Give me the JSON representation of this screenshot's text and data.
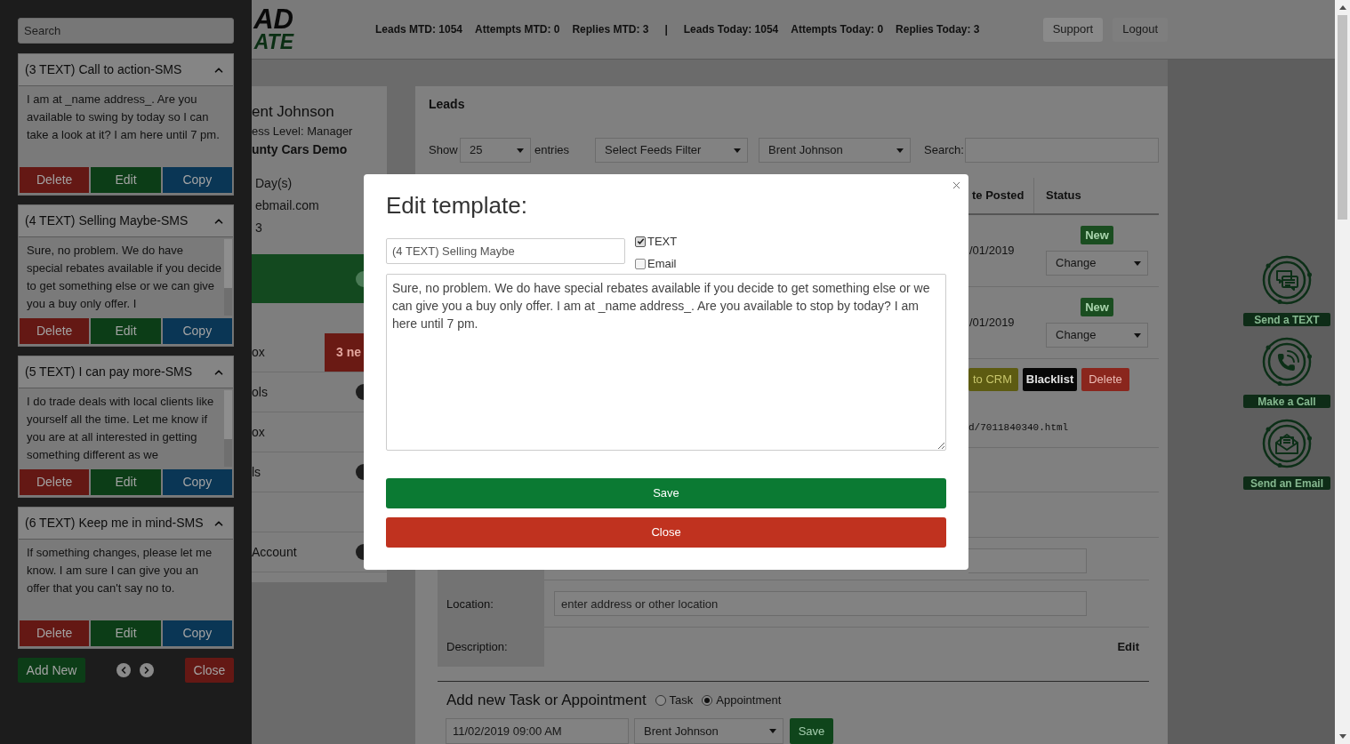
{
  "sidebar": {
    "search": {
      "placeholder": "Search"
    },
    "templates": [
      {
        "title": "(3 TEXT) Call to action-SMS",
        "expanded": true,
        "body": "I am at _name address_. Are you available to swing by today so I can take a look at it? I am here until 7 pm.",
        "scrollbar": false,
        "actions": [
          {
            "label": "Delete",
            "kind": "delete"
          },
          {
            "label": "Edit",
            "kind": "edit"
          },
          {
            "label": "Copy",
            "kind": "copy"
          }
        ]
      },
      {
        "title": "(4 TEXT) Selling Maybe-SMS",
        "expanded": true,
        "body": "Sure, no problem. We do have special rebates available if you decide to get something else or we can give you a buy only offer. I",
        "scrollbar": true,
        "actions": [
          {
            "label": "Delete",
            "kind": "delete"
          },
          {
            "label": "Edit",
            "kind": "edit"
          },
          {
            "label": "Copy",
            "kind": "copy"
          }
        ]
      },
      {
        "title": "(5 TEXT) I can pay more-SMS",
        "expanded": true,
        "body": "I do trade deals with local clients like yourself all the time. Let me know if you are at all interested in getting something different as we",
        "scrollbar": true,
        "actions": [
          {
            "label": "Delete",
            "kind": "delete"
          },
          {
            "label": "Edit",
            "kind": "edit"
          },
          {
            "label": "Copy",
            "kind": "copy"
          }
        ]
      },
      {
        "title": "(6 TEXT) Keep me in mind-SMS",
        "expanded": true,
        "body": "If something changes, please let me know. I am sure I can give you an offer that you can't say no to.",
        "scrollbar": false,
        "actions": [
          {
            "label": "Delete",
            "kind": "delete"
          },
          {
            "label": "Edit",
            "kind": "edit"
          },
          {
            "label": "Copy",
            "kind": "copy"
          }
        ]
      }
    ],
    "add_button": "Add New",
    "close_button": "Close"
  },
  "header": {
    "logo": [
      "AD",
      "ATE"
    ],
    "stats_month": [
      "Leads MTD: 1054",
      "Attempts MTD: 0",
      "Replies MTD: 3"
    ],
    "separator": "|",
    "stats_today": [
      "Leads Today: 1054",
      "Attempts Today: 0",
      "Replies Today: 3"
    ],
    "buttons": [
      {
        "label": "Support",
        "kind": "filled"
      },
      {
        "label": "Logout",
        "kind": "plain"
      }
    ]
  },
  "profile": {
    "name": "ent Johnson",
    "access_level": "ess Level: Manager",
    "company": "unty Cars Demo",
    "details": [
      "Day(s)",
      "ebmail.com",
      "3"
    ],
    "menu": [
      {
        "label": "ox",
        "badge": "3 ne",
        "dot": false
      },
      {
        "label": "ols",
        "dot": true
      },
      {
        "label": "ox",
        "dot": false
      },
      {
        "label": "ls",
        "dot": true
      },
      {
        "dot": false
      },
      {
        "label": "Account",
        "dot": true
      }
    ]
  },
  "leads": {
    "title": "Leads",
    "show_label": "Show",
    "page_size": "25",
    "entries_label": "entries",
    "filters": [
      "Select Feeds Filter",
      "Brent Johnson"
    ],
    "search_label": "Search:",
    "columns": [
      "te Posted",
      "Status"
    ],
    "rows": [
      {
        "date": "/01/2019",
        "status": "New",
        "action": "Change"
      },
      {
        "date": "/01/2019",
        "status": "New",
        "action": "Change"
      }
    ],
    "actions": [
      {
        "label": "to CRM",
        "kind": "crm"
      },
      {
        "label": "Blacklist",
        "kind": "blacklist"
      },
      {
        "label": "Delete",
        "kind": "delete"
      }
    ],
    "link": "d/7011840340.html"
  },
  "event_form": {
    "location_label": "Location:",
    "location_placeholder": "enter address or other location",
    "description_label": "Description:",
    "description_action": "Edit"
  },
  "new_task": {
    "title": "Add new Task or Appointment",
    "types": [
      {
        "label": "Task",
        "selected": false
      },
      {
        "label": "Appointment",
        "selected": true
      }
    ],
    "date": "11/02/2019 09:00 AM",
    "assignee": "Brent Johnson",
    "save": "Save"
  },
  "quick_actions": [
    {
      "label": "Send a TEXT",
      "kind": "text"
    },
    {
      "label": "Make a Call",
      "kind": "call"
    },
    {
      "label": "Send an Email",
      "kind": "email"
    }
  ],
  "modal": {
    "title": "Edit template:",
    "name_value": "(4 TEXT) Selling Maybe",
    "channels": [
      {
        "label": "TEXT",
        "checked": true
      },
      {
        "label": "Email",
        "checked": false
      }
    ],
    "message": "Sure, no problem. We do have special rebates available if you decide to get something else or we can give you a buy only offer. I am at _name address_. Are you available to stop by today? I am here until 7 pm.",
    "buttons": [
      {
        "label": "Save",
        "kind": "save"
      },
      {
        "label": "Close",
        "kind": "close"
      }
    ]
  }
}
